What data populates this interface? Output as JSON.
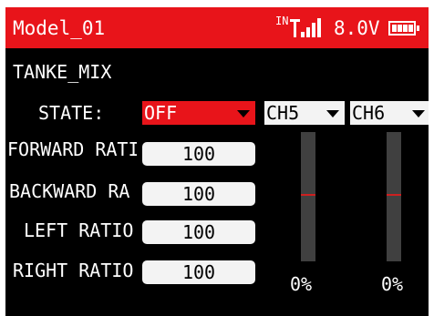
{
  "header": {
    "model_name": "Model_01",
    "signal_label": "IN",
    "voltage": "8.0V",
    "battery_level": 1.0
  },
  "screen": {
    "title": "TANKE_MIX",
    "state_label": "STATE:",
    "state_value": "OFF",
    "channels": [
      {
        "label": "CH5",
        "percent": "0%",
        "value": 0
      },
      {
        "label": "CH6",
        "percent": "0%",
        "value": 0
      }
    ],
    "ratios": [
      {
        "label": "FORWARD RATI",
        "value": "100"
      },
      {
        "label": "BACKWARD RA",
        "value": "100"
      },
      {
        "label": "LEFT RATIO",
        "value": "100"
      },
      {
        "label": "RIGHT RATIO",
        "value": "100"
      }
    ]
  },
  "colors": {
    "title_bar": "#e8141a",
    "background": "#000000",
    "field": "#f3f3f3",
    "bar_track": "#404040",
    "bar_center_mark": "#cc2020"
  }
}
